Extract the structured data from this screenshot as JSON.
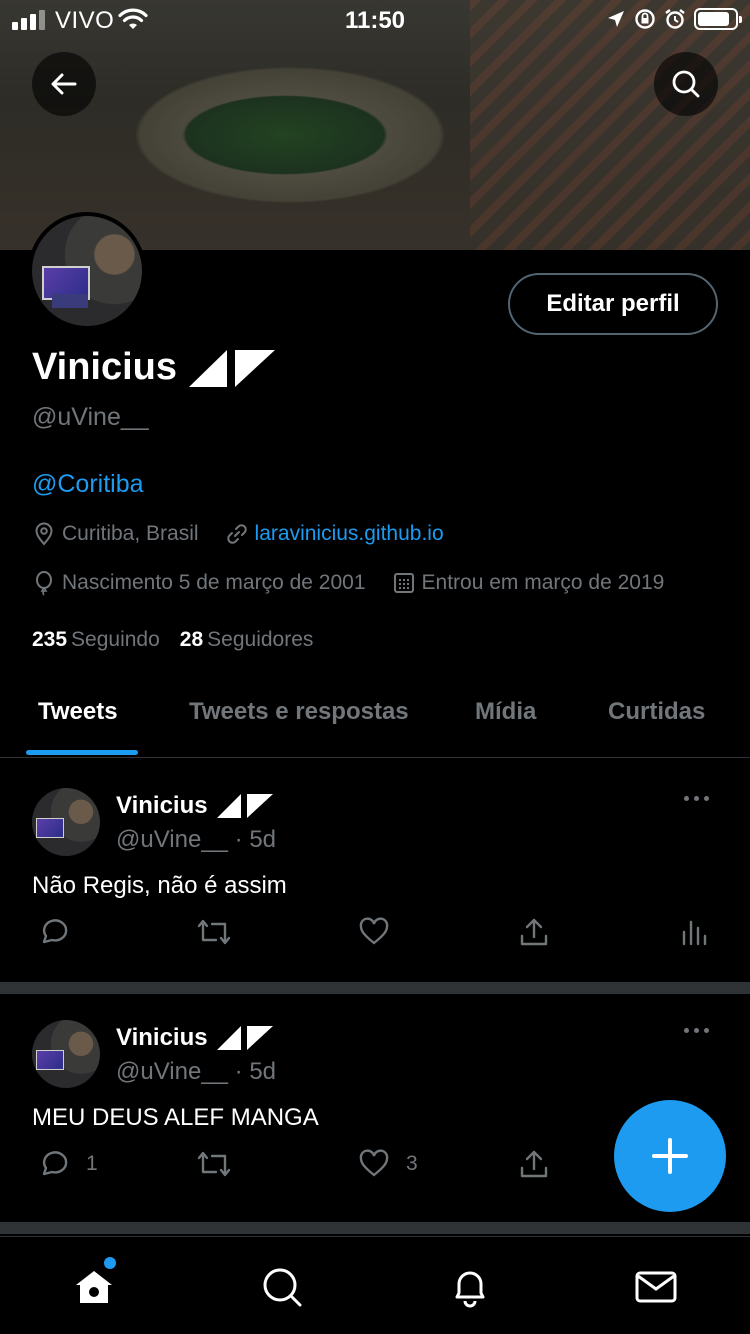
{
  "status_bar": {
    "carrier": "VIVO",
    "time": "11:50",
    "battery_level": 0.85
  },
  "profile": {
    "name": "Vinicius",
    "handle": "@uVine__",
    "bio_mention": "@Coritiba",
    "location": "Curitiba, Brasil",
    "website": "laravinicius.github.io",
    "birth": "Nascimento 5 de março de 2001",
    "joined": "Entrou em março de 2019",
    "following_count": "235",
    "following_label": "Seguindo",
    "followers_count": "28",
    "followers_label": "Seguidores",
    "edit_button": "Editar perfil"
  },
  "tabs": [
    {
      "label": "Tweets",
      "active": true
    },
    {
      "label": "Tweets e respostas",
      "active": false
    },
    {
      "label": "Mídia",
      "active": false
    },
    {
      "label": "Curtidas",
      "active": false
    }
  ],
  "tweets": [
    {
      "name": "Vinicius",
      "handle_time": "@uVine__ · 5d",
      "text": "Não Regis, não é assim",
      "replies": "",
      "likes": ""
    },
    {
      "name": "Vinicius",
      "handle_time": "@uVine__ · 5d",
      "text": "MEU DEUS ALEF MANGA",
      "replies": "1",
      "likes": "3"
    }
  ],
  "colors": {
    "accent": "#1d9bf0",
    "muted": "#71767b",
    "border": "#2f3336",
    "background": "#000000"
  },
  "icons": {
    "back": "arrow-left-icon",
    "search": "search-icon",
    "location": "map-pin-icon",
    "link": "link-icon",
    "birthday": "balloon-icon",
    "calendar": "calendar-icon",
    "reply": "reply-icon",
    "retweet": "retweet-icon",
    "like": "heart-icon",
    "share": "share-icon",
    "analytics": "analytics-icon",
    "compose": "plus-icon",
    "home": "home-icon",
    "notifications": "bell-icon",
    "messages": "mail-icon"
  }
}
